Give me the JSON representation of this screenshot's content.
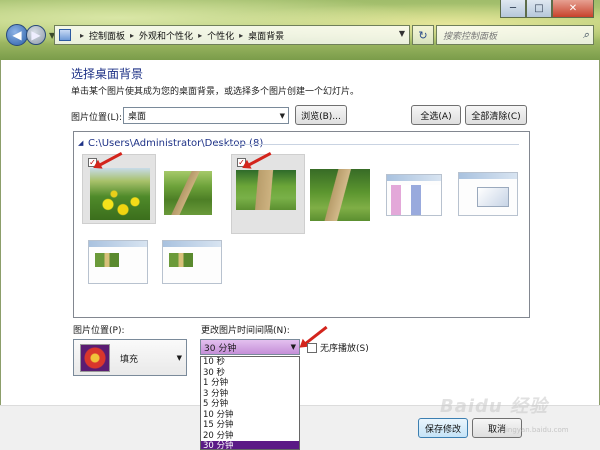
{
  "window": {
    "minimize_glyph": "─",
    "maximize_glyph": "□",
    "close_glyph": "✕"
  },
  "breadcrumb": {
    "items": [
      "控制面板",
      "外观和个性化",
      "个性化",
      "桌面背景"
    ]
  },
  "search": {
    "placeholder": "搜索控制面板"
  },
  "heading": "选择桌面背景",
  "subtext": "单击某个图片使其成为您的桌面背景，或选择多个图片创建一个幻灯片。",
  "location": {
    "label": "图片位置(L):",
    "value": "桌面",
    "browse_label": "浏览(B)...",
    "select_all_label": "全选(A)",
    "clear_all_label": "全部清除(C)"
  },
  "gallery": {
    "path": "C:\\Users\\Administrator\\Desktop (8)",
    "images": [
      {
        "kind": "flowers",
        "checked": true,
        "selected": true
      },
      {
        "kind": "road",
        "checked": false,
        "selected": false
      },
      {
        "kind": "road2",
        "checked": true,
        "selected": true
      },
      {
        "kind": "road3",
        "checked": false,
        "selected": false
      },
      {
        "kind": "screenshot",
        "checked": false,
        "selected": false
      },
      {
        "kind": "screenshot",
        "checked": false,
        "selected": false
      },
      {
        "kind": "screenshot",
        "checked": false,
        "selected": false
      },
      {
        "kind": "screenshot",
        "checked": false,
        "selected": false
      }
    ],
    "check_glyph": "✓"
  },
  "position": {
    "label": "图片位置(P):",
    "value": "填充"
  },
  "interval": {
    "label": "更改图片时间间隔(N):",
    "value": "30 分钟",
    "options": [
      "10 秒",
      "30 秒",
      "1 分钟",
      "3 分钟",
      "5 分钟",
      "10 分钟",
      "15 分钟",
      "20 分钟",
      "30 分钟"
    ],
    "highlighted_index": 8
  },
  "shuffle": {
    "label": "无序播放(S)",
    "checked": false
  },
  "footer": {
    "save_label": "保存修改",
    "cancel_label": "取消"
  },
  "watermark": {
    "text": "Baidu 经验",
    "sub": "jingyan.baidu.com"
  },
  "colors": {
    "accent": "#1e3287",
    "arrow_red": "#d3241c",
    "highlight": "#5b1a86"
  }
}
